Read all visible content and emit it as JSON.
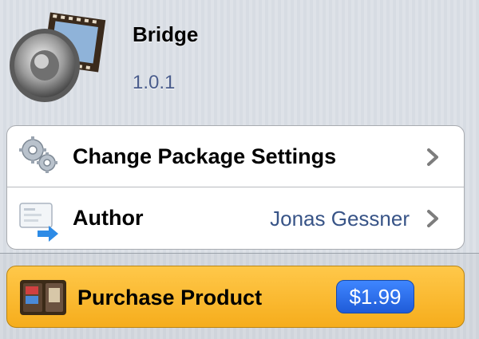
{
  "package": {
    "title": "Bridge",
    "version": "1.0.1",
    "icon": "speaker-filmstrip-icon"
  },
  "rows": [
    {
      "label": "Change Package Settings",
      "value": "",
      "icon": "gears-icon"
    },
    {
      "label": "Author",
      "value": "Jonas Gessner",
      "icon": "contact-card-arrow-icon"
    }
  ],
  "purchase": {
    "label": "Purchase Product",
    "price": "$1.99",
    "icon": "wallet-icon",
    "color": "#f6ad1c",
    "badge_color": "#2f6fe8"
  }
}
